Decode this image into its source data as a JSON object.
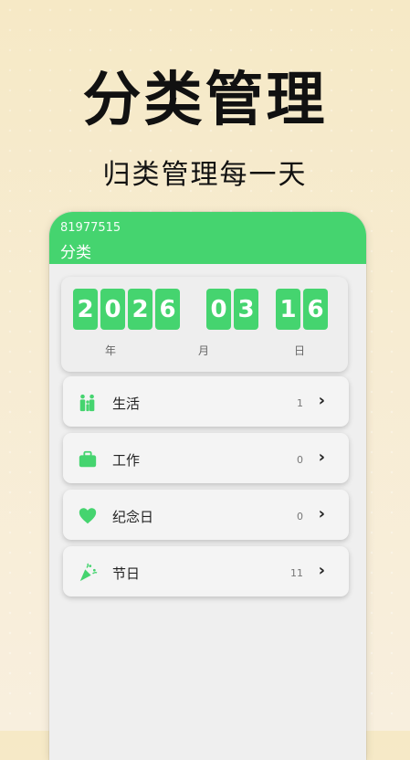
{
  "hero": {
    "title": "分类管理",
    "subtitle": "归类管理每一天"
  },
  "app": {
    "user_id": "81977515",
    "page_title": "分类"
  },
  "date": {
    "year_digits": [
      "2",
      "0",
      "2",
      "6"
    ],
    "month_digits": [
      "0",
      "3"
    ],
    "day_digits": [
      "1",
      "6"
    ],
    "year_label": "年",
    "month_label": "月",
    "day_label": "日"
  },
  "categories": [
    {
      "label": "生活",
      "count": "1",
      "icon": "family-icon"
    },
    {
      "label": "工作",
      "count": "0",
      "icon": "briefcase-icon"
    },
    {
      "label": "纪念日",
      "count": "0",
      "icon": "heart-icon"
    },
    {
      "label": "节日",
      "count": "11",
      "icon": "party-popper-icon"
    }
  ],
  "colors": {
    "accent": "#45d46f",
    "background": "#f6e9c6"
  }
}
